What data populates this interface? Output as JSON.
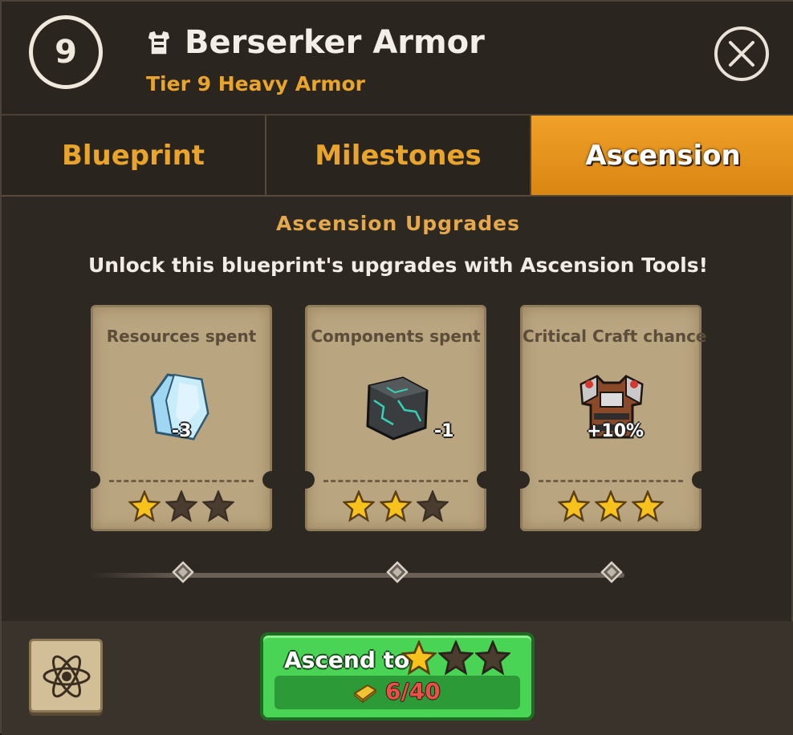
{
  "header": {
    "tier_number": "9",
    "item_name": "Berserker Armor",
    "item_subtitle": "Tier 9 Heavy Armor",
    "armor_icon": "armor-icon",
    "close_icon": "close-icon"
  },
  "tabs": [
    {
      "label": "Blueprint",
      "active": false
    },
    {
      "label": "Milestones",
      "active": false
    },
    {
      "label": "Ascension",
      "active": true
    }
  ],
  "section": {
    "title": "Ascension Upgrades",
    "description": "Unlock this blueprint's upgrades with Ascension Tools!"
  },
  "cards": [
    {
      "label": "Resources spent",
      "icon": "crystal-shard-icon",
      "value": "-3",
      "stars_filled": 1,
      "stars_total": 3
    },
    {
      "label": "Components spent",
      "icon": "cracked-stone-cube-icon",
      "value": "-1",
      "stars_filled": 2,
      "stars_total": 3
    },
    {
      "label": "Critical Craft chance",
      "icon": "chest-armor-icon",
      "value": "+10%",
      "stars_filled": 3,
      "stars_total": 3
    }
  ],
  "track": {
    "nodes": 3
  },
  "footer": {
    "atom_icon": "atom-icon",
    "ascend_label": "Ascend to",
    "ascend_stars_filled": 1,
    "ascend_stars_total": 3,
    "cost_icon": "gold-bar-icon",
    "cost_text": "6/40"
  },
  "colors": {
    "accent_orange": "#e9a52b",
    "active_tab": "#f0a12a",
    "card_bg": "#b9a57f",
    "button_green": "#4ad456",
    "cost_red": "#e8504a",
    "star_gold": "#f6c21b",
    "star_empty": "#4a3d30"
  }
}
